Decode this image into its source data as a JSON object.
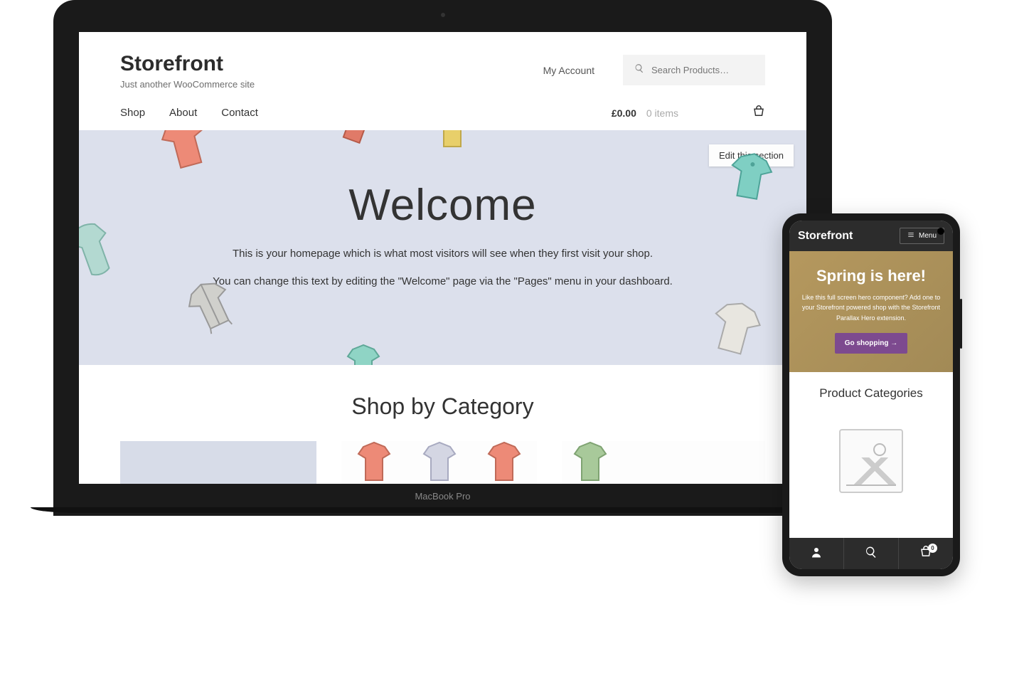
{
  "devices": {
    "laptop_label": "MacBook Pro"
  },
  "desktop": {
    "site_title": "Storefront",
    "tagline": "Just another WooCommerce site",
    "my_account": "My Account",
    "search_placeholder": "Search Products…",
    "nav": {
      "items": [
        "Shop",
        "About",
        "Contact"
      ]
    },
    "cart": {
      "total": "£0.00",
      "items_label": "0 items"
    },
    "edit_label": "Edit this section",
    "hero": {
      "title": "Welcome",
      "line1": "This is your homepage which is what most visitors will see when they first visit your shop.",
      "line2": "You can change this text by editing the \"Welcome\" page via the \"Pages\" menu in your dashboard."
    },
    "categories_title": "Shop by Category"
  },
  "mobile": {
    "site_title": "Storefront",
    "menu_label": "Menu",
    "hero": {
      "title": "Spring is here!",
      "body": "Like this full screen hero component? Add one to your Storefront powered shop with the Storefront Parallax Hero extension.",
      "button": "Go shopping →"
    },
    "categories_title": "Product Categories",
    "cart_badge": "0"
  }
}
